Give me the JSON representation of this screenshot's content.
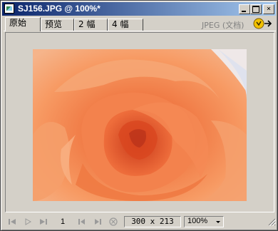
{
  "window": {
    "title": "SJ156.JPG @ 100%*"
  },
  "tabs": [
    {
      "label": "原始"
    },
    {
      "label": "预览"
    },
    {
      "label": "2 幅"
    },
    {
      "label": "4 幅"
    }
  ],
  "status": {
    "format_label": "JPEG (文档)"
  },
  "image": {
    "description_icon": "rose-photo"
  },
  "bottom": {
    "page": "1",
    "dimensions": "300 x 213",
    "zoom": "100%"
  },
  "colors": {
    "title_start": "#0a246a",
    "title_end": "#a6caf0",
    "chrome": "#d4d0c8"
  }
}
